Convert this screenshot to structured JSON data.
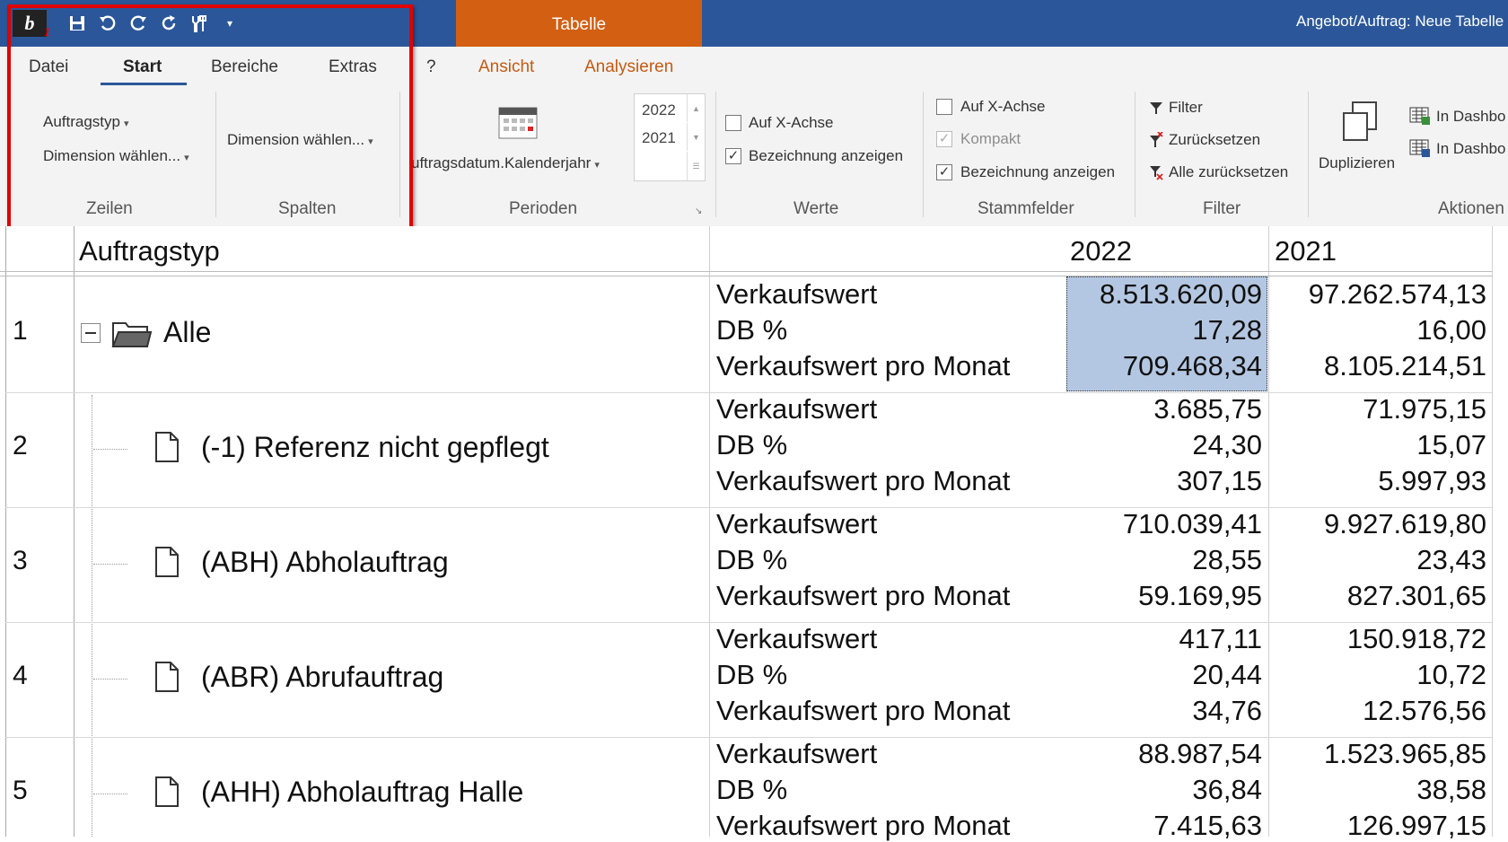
{
  "titlebar": {
    "context_tab": "Tabelle",
    "window_title": "Angebot/Auftrag: Neue Tabelle",
    "qat_icons": [
      "save-icon",
      "undo-icon",
      "redo-icon",
      "refresh-icon",
      "tools-icon",
      "customize-icon"
    ]
  },
  "tabs": [
    {
      "label": "Datei"
    },
    {
      "label": "Start",
      "active": true
    },
    {
      "label": "Bereiche"
    },
    {
      "label": "Extras"
    },
    {
      "label": "?"
    },
    {
      "label": "Ansicht",
      "context": true
    },
    {
      "label": "Analysieren",
      "context": true
    }
  ],
  "ribbon": {
    "zeilen": {
      "items": [
        "Auftragstyp",
        "Dimension wählen..."
      ],
      "label": "Zeilen"
    },
    "spalten": {
      "items": [
        "Dimension wählen..."
      ],
      "label": "Spalten"
    },
    "perioden": {
      "field": "uftragsdatum.Kalenderjahr",
      "years": [
        "2022",
        "2021"
      ],
      "label": "Perioden"
    },
    "werte": {
      "checkboxes": [
        {
          "label": "Auf X-Achse",
          "checked": false
        },
        {
          "label": "Bezeichnung anzeigen",
          "checked": true
        }
      ],
      "label": "Werte"
    },
    "stammfelder": {
      "checkboxes": [
        {
          "label": "Auf X-Achse",
          "checked": false
        },
        {
          "label": "Kompakt",
          "checked": true,
          "disabled": true
        },
        {
          "label": "Bezeichnung anzeigen",
          "checked": true
        }
      ],
      "label": "Stammfelder"
    },
    "filter": {
      "buttons": [
        "Filter",
        "Zurücksetzen",
        "Alle zurücksetzen"
      ],
      "label": "Filter"
    },
    "aktionen": {
      "duplicate": "Duplizieren",
      "dashboard1": "In Dashbo",
      "dashboard2": "In Dashbo",
      "label": "Aktionen"
    }
  },
  "table": {
    "header": {
      "dimension": "Auftragstyp",
      "col1": "2022",
      "col2": "2021"
    },
    "measures": [
      "Verkaufswert",
      "DB %",
      "Verkaufswert pro Monat"
    ],
    "rows": [
      {
        "num": "1",
        "label": "Alle",
        "v2022": [
          "8.513.620,09",
          "17,28",
          "709.468,34"
        ],
        "v2021": [
          "97.262.574,13",
          "16,00",
          "8.105.214,51"
        ]
      },
      {
        "num": "2",
        "label": "(-1) Referenz nicht gepflegt",
        "v2022": [
          "3.685,75",
          "24,30",
          "307,15"
        ],
        "v2021": [
          "71.975,15",
          "15,07",
          "5.997,93"
        ]
      },
      {
        "num": "3",
        "label": "(ABH) Abholauftrag",
        "v2022": [
          "710.039,41",
          "28,55",
          "59.169,95"
        ],
        "v2021": [
          "9.927.619,80",
          "23,43",
          "827.301,65"
        ]
      },
      {
        "num": "4",
        "label": "(ABR) Abrufauftrag",
        "v2022": [
          "417,11",
          "20,44",
          "34,76"
        ],
        "v2021": [
          "150.918,72",
          "10,72",
          "12.576,56"
        ]
      },
      {
        "num": "5",
        "label": "(AHH) Abholauftrag Halle",
        "v2022": [
          "88.987,54",
          "36,84",
          "7.415,63"
        ],
        "v2021": [
          "1.523.965,85",
          "38,58",
          "126.997,15"
        ]
      }
    ]
  }
}
